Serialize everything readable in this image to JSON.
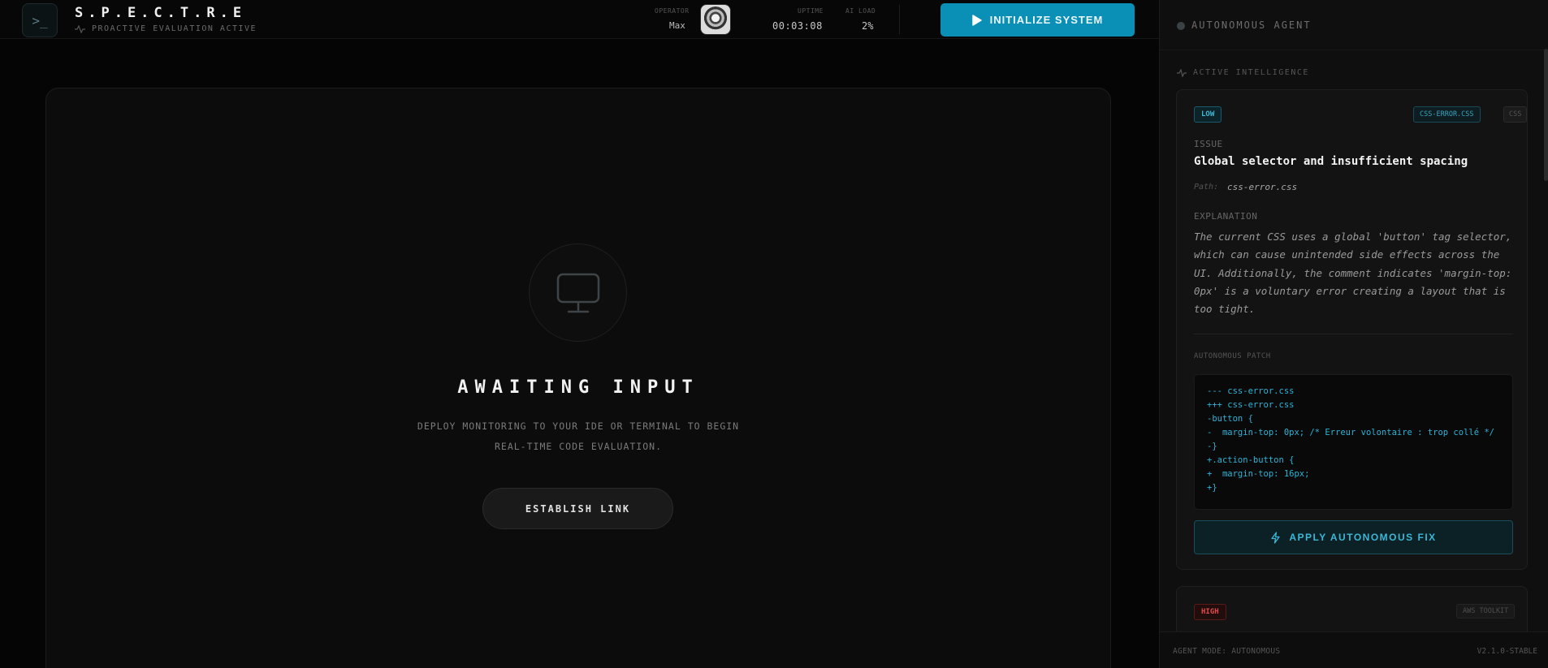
{
  "header": {
    "logo_glyph": ">_",
    "brand": "S.P.E.C.T.R.E",
    "subtitle": "PROACTIVE EVALUATION ACTIVE",
    "operator_label": "OPERATOR",
    "operator_name": "Max",
    "uptime_label": "UPTIME",
    "uptime_value": "00:03:08",
    "ai_load_label": "AI LOAD",
    "ai_load_value": "2%",
    "init_button": "INITIALIZE SYSTEM",
    "accent_color": "#0a8fb6"
  },
  "main": {
    "title": "AWAITING INPUT",
    "subtitle": "DEPLOY MONITORING TO YOUR IDE OR TERMINAL TO BEGIN REAL-TIME CODE EVALUATION.",
    "link_button": "ESTABLISH LINK",
    "icon": "monitor-icon"
  },
  "panel": {
    "title": "AUTONOMOUS AGENT",
    "section_label": "ACTIVE INTELLIGENCE",
    "issues": [
      {
        "severity": "LOW",
        "file_tag": "CSS-ERROR.CSS",
        "lang_tag": "CSS",
        "issue_label": "ISSUE",
        "issue_title": "Global selector and insufficient spacing",
        "path_label": "Path:",
        "path_value": "css-error.css",
        "explanation_label": "EXPLANATION",
        "explanation": "The current CSS uses a global 'button' tag selector, which can cause unintended side effects across the UI. Additionally, the comment indicates 'margin-top: 0px' is a voluntary error creating a layout that is too tight.",
        "patch_label": "AUTONOMOUS PATCH",
        "patch": "--- css-error.css\n+++ css-error.css\n-button {\n-  margin-top: 0px; /* Erreur volontaire : trop collé */\n-}\n+.action-button {\n+  margin-top: 16px;\n+}",
        "apply_button": "APPLY AUTONOMOUS FIX"
      },
      {
        "severity": "HIGH",
        "file_tag": "AWS TOOLKIT"
      }
    ],
    "footer_mode": "AGENT MODE: AUTONOMOUS",
    "footer_version": "V2.1.0-STABLE",
    "low_color": "#3fb8d6",
    "high_color": "#e04a4a"
  }
}
